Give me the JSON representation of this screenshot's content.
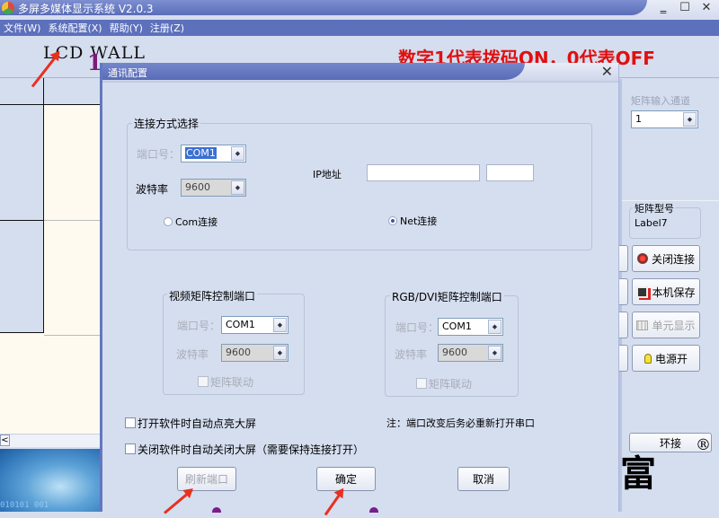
{
  "window": {
    "title": "多屏多媒体显示系统 V2.0.3",
    "minimize": "‗",
    "maximize": "☐",
    "close": "✕"
  },
  "menu": [
    {
      "label": "文件(W)"
    },
    {
      "label": "系统配置(X)"
    },
    {
      "label": "帮助(Y)"
    },
    {
      "label": "注册(Z)"
    }
  ],
  "main": {
    "lcd_title": "LCD WALL",
    "lcd_number": "1",
    "note_red": "数字1代表拨码ON，0代表OFF",
    "scroll_left": "<"
  },
  "right_panel": {
    "matrix_input_label": "矩阵输入通道",
    "matrix_input_value": "1",
    "matrix_model_title": "矩阵型号",
    "matrix_model_value": "Label7",
    "buttons": [
      {
        "label": "关闭连接",
        "icon": "red-record-icon",
        "enabled": true
      },
      {
        "label": "本机保存",
        "icon": "save-icon",
        "enabled": true
      },
      {
        "label": "单元显示",
        "icon": "grid-icon",
        "enabled": false
      },
      {
        "label": "电源开",
        "icon": "bulb-icon",
        "enabled": true
      }
    ],
    "loop_button": "环接",
    "brand": "卡迪富",
    "registered": "®"
  },
  "dialog": {
    "title": "通讯配置",
    "close": "✕",
    "connection": {
      "group_title": "连接方式选择",
      "port_label": "端口号：",
      "port_value": "COM1",
      "baud_label": "波特率",
      "baud_value": "9600",
      "ip_label": "IP地址",
      "ip_value": "",
      "ip_port_value": "",
      "radio_com": "Com连接",
      "radio_net": "Net连接",
      "selected": "net"
    },
    "video_matrix": {
      "group_title": "视频矩阵控制端口",
      "port_label": "端口号：",
      "port_value": "COM1",
      "baud_label": "波特率",
      "baud_value": "9600",
      "link_label": "矩阵联动",
      "link_checked": false
    },
    "rgb_matrix": {
      "group_title": "RGB/DVI矩阵控制端口",
      "port_label": "端口号：",
      "port_value": "COM1",
      "baud_label": "波特率",
      "baud_value": "9600",
      "link_label": "矩阵联动",
      "link_checked": false
    },
    "auto_on_label": "打开软件时自动点亮大屏",
    "auto_on_checked": false,
    "auto_off_label": "关闭软件时自动关闭大屏（需要保持连接打开）",
    "auto_off_checked": false,
    "note": "注：端口改变后务必重新打开串口",
    "btn_refresh": "刷新端口",
    "btn_ok": "确定",
    "btn_cancel": "取消"
  }
}
